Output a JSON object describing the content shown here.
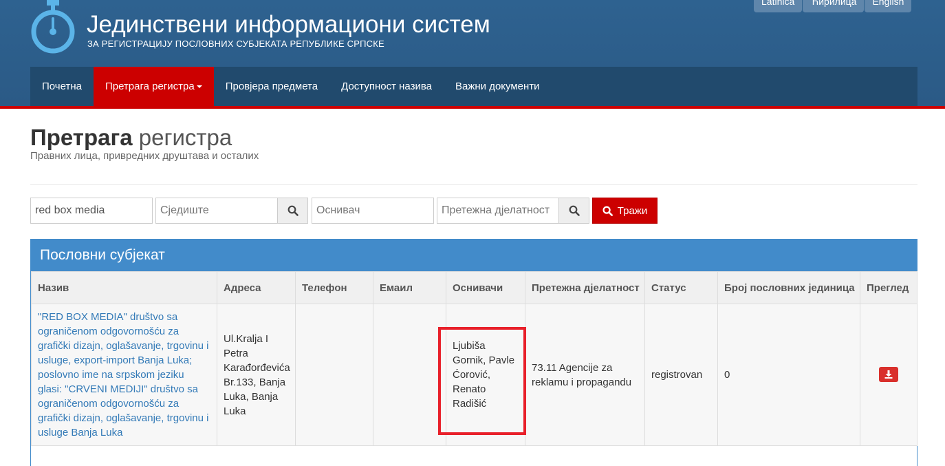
{
  "header": {
    "title": "Јединствени информациони систем",
    "subtitle": "ЗА РЕГИСТРАЦИЈУ ПОСЛОВНИХ СУБЈЕКАТА РЕПУБЛИКЕ СРПСКЕ",
    "languages": [
      "Latinica",
      "Ћирилица",
      "English"
    ]
  },
  "nav": {
    "items": [
      "Почетна",
      "Претрага регистра",
      "Провјера предмета",
      "Доступност назива",
      "Важни документи"
    ],
    "active_index": 1
  },
  "page": {
    "title_strong": "Претрага",
    "title_light": "регистра",
    "subtitle": "Правних лица, привредних друштава и осталих"
  },
  "search": {
    "name_value": "red box media",
    "seat_placeholder": "Сједиште",
    "founder_placeholder": "Оснивач",
    "activity_placeholder": "Претежна дјелатност",
    "submit_label": "Тражи"
  },
  "results": {
    "panel_title": "Пословни субјекат",
    "columns": [
      "Назив",
      "Адреса",
      "Телефон",
      "Емаил",
      "Оснивачи",
      "Претежна дјелатност",
      "Статус",
      "Број пословних јединица",
      "Преглед"
    ],
    "rows": [
      {
        "name": "\"RED BOX MEDIA\" društvo sa ograničenom odgovornošću za grafički dizajn, oglašavanje, trgovinu i usluge, export-import Banja Luka; poslovno ime na srpskom jeziku glasi: \"CRVENI MEDIJI\" društvo sa ograničenom odgovornošću za grafički dizajn, oglašavanje, trgovinu i usluge Banja Luka",
        "address": "Ul.Kralja I Petra Karađorđevića Br.133, Banja Luka, Banja Luka",
        "phone": "",
        "email": "",
        "founders": "Ljubiša Gornik, Pavle Ćorović, Renato Radišić",
        "activity": "73.11 Agencije za reklamu i propagandu",
        "status": "registrovan",
        "units": "0"
      }
    ]
  },
  "colors": {
    "header_bg": "#2e6290",
    "nav_bg": "#214a6d",
    "accent_red": "#cc0000",
    "panel_blue": "#428bca",
    "link_blue": "#337ab7",
    "highlight_red": "#e8202a"
  },
  "icons": {
    "logo": "stopwatch-icon",
    "search": "search-icon",
    "download": "pdf-download-icon"
  }
}
